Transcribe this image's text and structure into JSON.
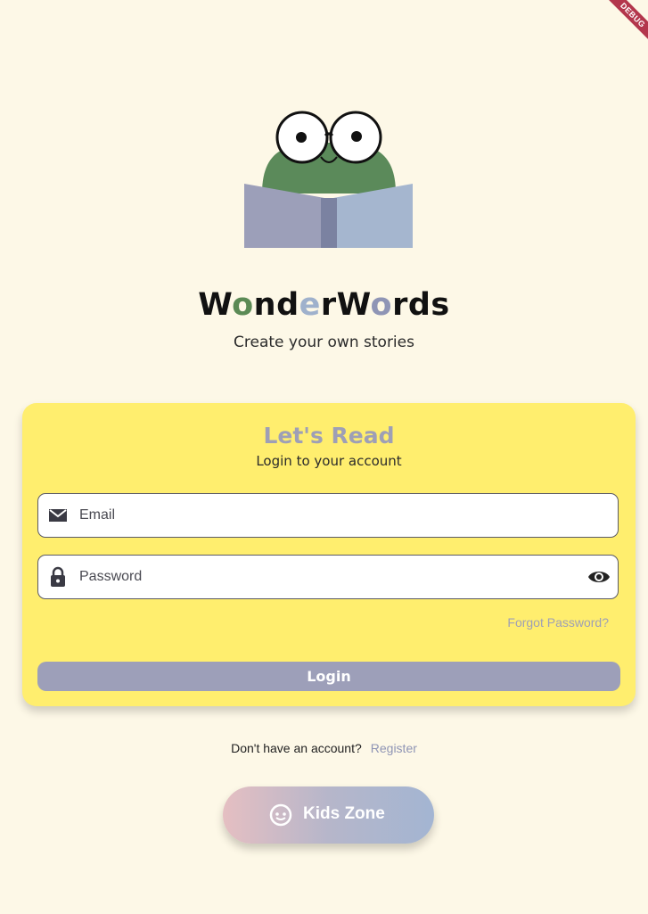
{
  "app": {
    "title_parts": [
      "W",
      "o",
      "nd",
      "e",
      "rW",
      "o",
      "rds"
    ],
    "tagline": "Create your own stories",
    "debug_banner": "DEBUG"
  },
  "login_card": {
    "title": "Let's Read",
    "subtitle": "Login to your account",
    "email_placeholder": "Email",
    "password_placeholder": "Password",
    "forgot_label": "Forgot Password?",
    "login_label": "Login"
  },
  "register": {
    "prompt": "Don't have an account?",
    "link_label": "Register"
  },
  "kids_zone": {
    "label": "Kids Zone"
  },
  "icons": {
    "email": "mail-icon",
    "password": "lock-icon",
    "visibility": "eye-icon",
    "kids": "face-icon",
    "mascot": "frog-reading-book-illustration"
  },
  "colors": {
    "background": "#fdf8e7",
    "card": "#ffee6e",
    "accent_purple": "#9e9fb6",
    "accent_green": "#5b8a55",
    "accent_blue": "#9fb1cc"
  }
}
